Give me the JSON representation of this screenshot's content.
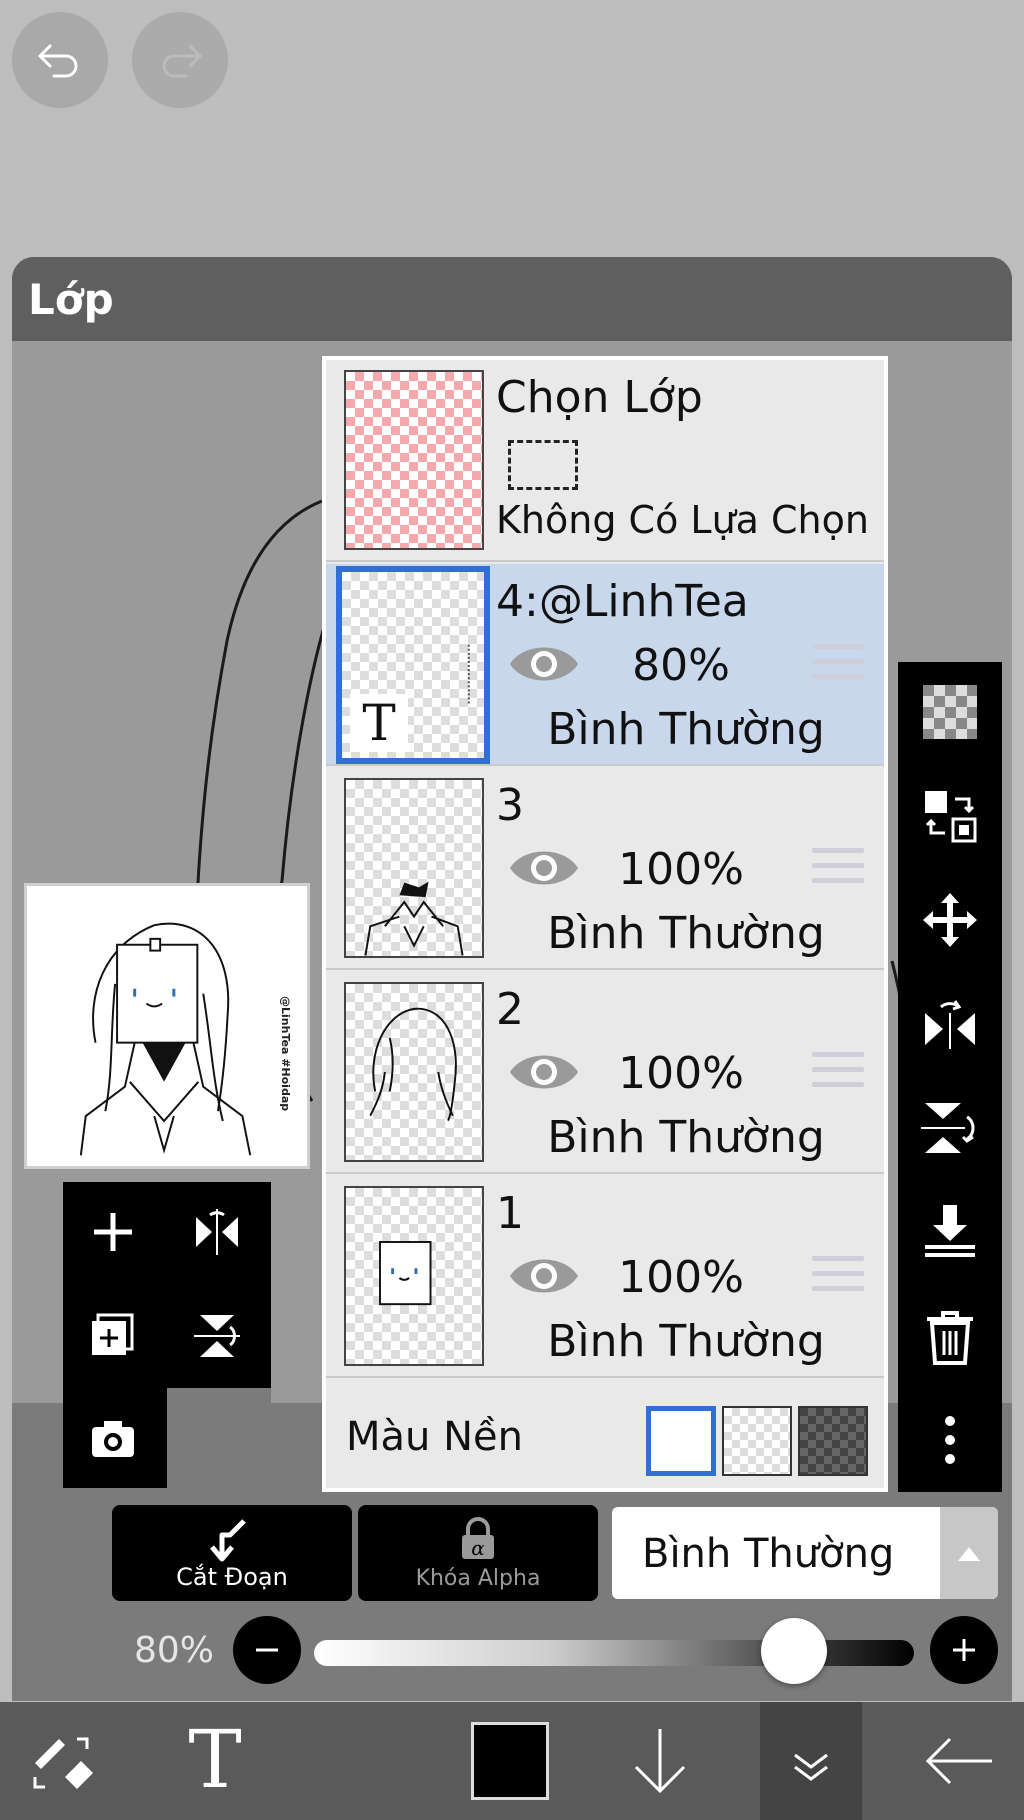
{
  "top": {
    "undo_icon": "undo-icon",
    "redo_icon": "redo-icon"
  },
  "panel": {
    "title": "Lớp"
  },
  "preview": {
    "text": "@LinhTea #Hoidap"
  },
  "selection_layer": {
    "title": "Chọn Lớp",
    "status": "Không Có Lựa Chọn"
  },
  "layers": [
    {
      "name": "4:@LinhTea",
      "opacity": "80%",
      "blend": "Bình Thường",
      "selected": true
    },
    {
      "name": "3",
      "opacity": "100%",
      "blend": "Bình Thường",
      "selected": false
    },
    {
      "name": "2",
      "opacity": "100%",
      "blend": "Bình Thường",
      "selected": false
    },
    {
      "name": "1",
      "opacity": "100%",
      "blend": "Bình Thường",
      "selected": false
    }
  ],
  "background": {
    "label": "Màu Nền",
    "options": [
      "white",
      "transparent",
      "dark"
    ],
    "selected": "white"
  },
  "controls": {
    "clip_label": "Cắt Đoạn",
    "alpha_lock_label": "Khóa Alpha",
    "blend_mode": "Bình Thường",
    "opacity_label": "80%",
    "opacity_value": 0.8
  },
  "colors": {
    "accent": "#2f6fd6",
    "selected_row": "#c9d7ec",
    "panel": "#7b7b7b",
    "current_color": "#000000"
  }
}
